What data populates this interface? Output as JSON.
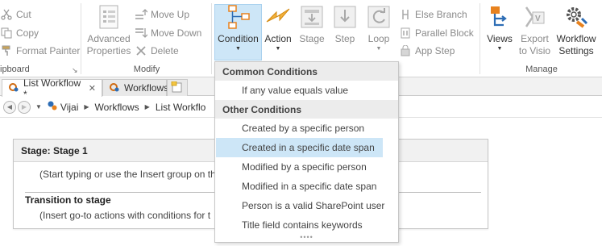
{
  "ribbon": {
    "clipboard": {
      "cut_label": "Cut",
      "copy_label": "Copy",
      "format_painter_label": "Format Painter",
      "group_label": "ipboard"
    },
    "modify": {
      "advanced_properties_label_1": "Advanced",
      "advanced_properties_label_2": "Properties",
      "move_up_label": "Move Up",
      "move_down_label": "Move Down",
      "delete_label": "Delete",
      "group_label": "Modify"
    },
    "insert": {
      "condition_label": "Condition",
      "action_label": "Action",
      "stage_label": "Stage",
      "step_label": "Step",
      "loop_label": "Loop",
      "else_branch_label": "Else Branch",
      "parallel_block_label": "Parallel Block",
      "app_step_label": "App Step"
    },
    "manage": {
      "views_label": "Views",
      "export_label_1": "Export",
      "export_label_2": "to Visio",
      "workflow_settings_label_1": "Workflow",
      "workflow_settings_label_2": "Settings",
      "group_label": "Manage"
    }
  },
  "tabs": [
    {
      "label": "List Workflow *"
    },
    {
      "label": "Workflows"
    }
  ],
  "breadcrumb": [
    "Vijai",
    "Workflows",
    "List Workflo"
  ],
  "stage": {
    "title": "Stage: Stage 1",
    "hint": "(Start typing or use the Insert group on th",
    "transition_title": "Transition to stage",
    "transition_hint": "(Insert go-to actions with conditions for t"
  },
  "dropdown": {
    "common_header": "Common Conditions",
    "common_items": [
      "If any value equals value"
    ],
    "other_header": "Other Conditions",
    "other_items": [
      "Created by a specific person",
      "Created in a specific date span",
      "Modified by a specific person",
      "Modified in a specific date span",
      "Person is a valid SharePoint user",
      "Title field contains keywords"
    ],
    "highlighted_item": "Created in a specific date span",
    "grip": "••••"
  },
  "colors": {
    "accent_selected": "#cde6f7",
    "icon_blue": "#2d6db5",
    "icon_orange": "#e8821e"
  }
}
